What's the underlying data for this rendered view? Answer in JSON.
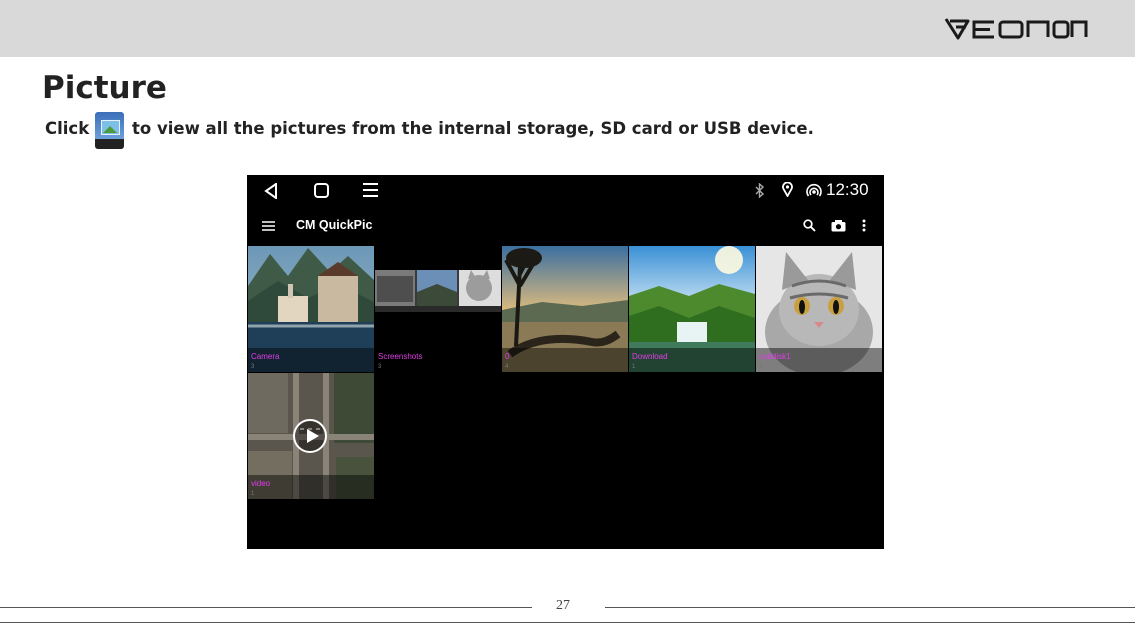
{
  "header": {
    "logo_text": "EONON",
    "brand_color": "#1a1a1a"
  },
  "page": {
    "title": "Picture",
    "instruction_before": "Click",
    "instruction_after": "to view all the pictures from the internal storage, SD card or USB device.",
    "instruction_icon": "quickpic-app-icon",
    "page_number": "27"
  },
  "device": {
    "nav_icons": [
      "back-icon",
      "home-icon",
      "menu-icon"
    ],
    "status_icons": [
      "bluetooth-icon",
      "location-icon",
      "hotspot-icon"
    ],
    "time": "12:30",
    "app_title": "CM QuickPic",
    "appbar_icons": [
      "hamburger-icon",
      "search-icon",
      "camera-icon",
      "more-vert-icon"
    ],
    "folders": [
      {
        "label": "Camera",
        "count": "3"
      },
      {
        "label": "Screenshots",
        "count": "3"
      },
      {
        "label": "0",
        "count": "4"
      },
      {
        "label": "Download",
        "count": "1"
      },
      {
        "label": "usbdisk1",
        "count": "4"
      },
      {
        "label": "video",
        "count": "1"
      }
    ]
  }
}
